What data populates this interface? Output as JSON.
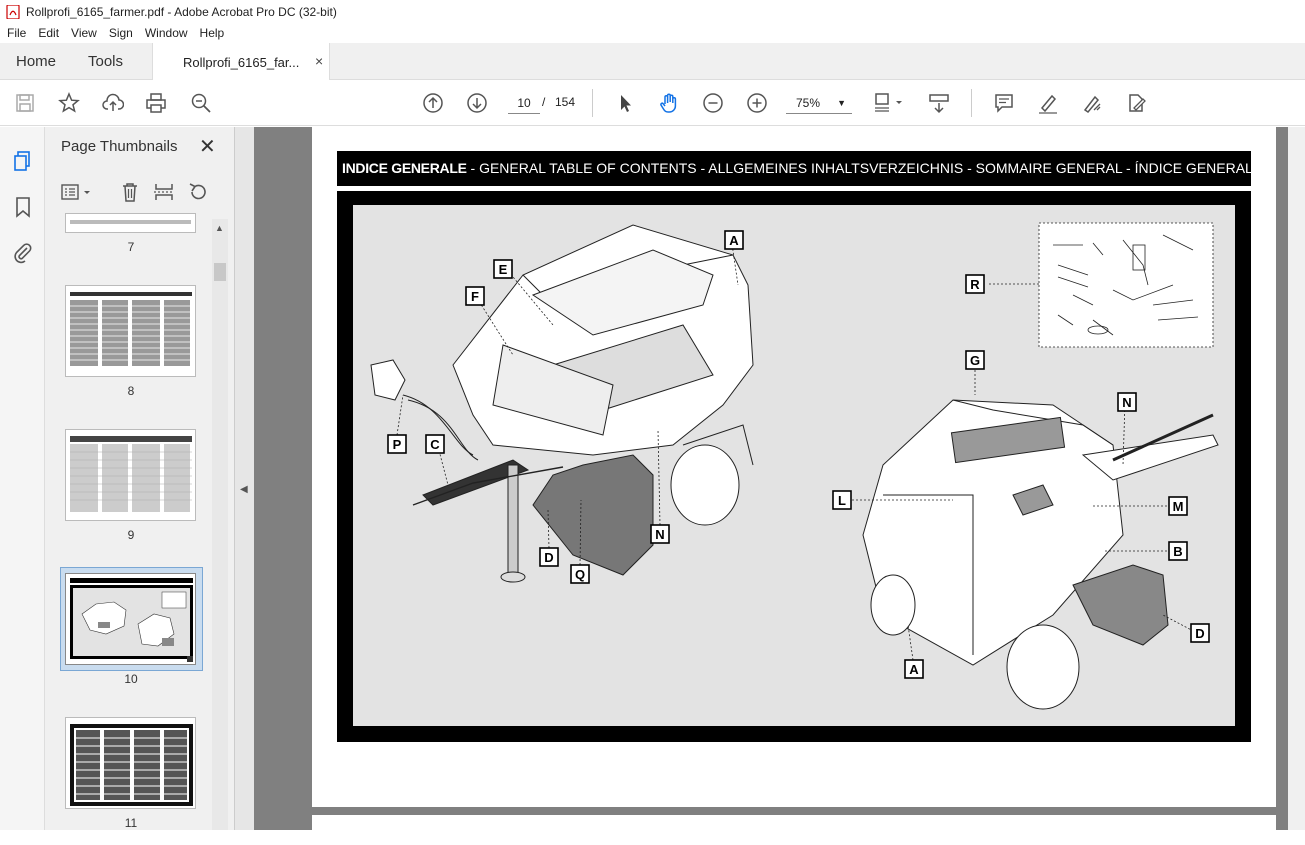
{
  "window": {
    "title": "Rollprofi_6165_farmer.pdf - Adobe Acrobat Pro DC (32-bit)"
  },
  "menu": [
    "File",
    "Edit",
    "View",
    "Sign",
    "Window",
    "Help"
  ],
  "tabs": {
    "home": "Home",
    "tools": "Tools",
    "document": "Rollprofi_6165_far...",
    "close": "×"
  },
  "toolbar": {
    "page_current": "10",
    "page_sep": "/",
    "page_total": "154",
    "zoom": "75%"
  },
  "thumbnails": {
    "title": "Page Thumbnails",
    "close": "✕",
    "pages": [
      "7",
      "8",
      "9",
      "10",
      "11"
    ],
    "selected": "10"
  },
  "document": {
    "header_bold": "INDICE GENERALE",
    "header_rest": " - GENERAL TABLE OF CONTENTS - ALLGEMEINES INHALTSVERZEICHNIS - SOMMAIRE GENERAL - ÍNDICE GENERAL",
    "callouts_left": [
      "A",
      "E",
      "F",
      "P",
      "C",
      "D",
      "Q",
      "N"
    ],
    "callouts_right": [
      "R",
      "G",
      "N",
      "L",
      "M",
      "B",
      "A",
      "D"
    ]
  },
  "colors": {
    "accent": "#1473e6",
    "selection": "#c9dcef",
    "doc_bg": "#808080"
  }
}
